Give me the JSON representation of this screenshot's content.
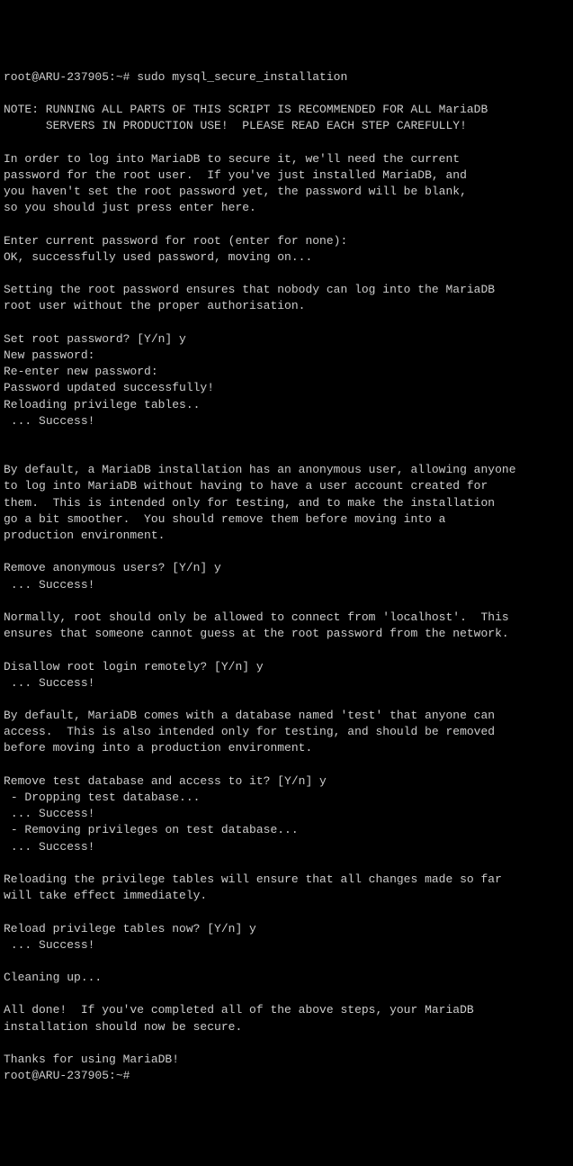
{
  "terminal": {
    "lines": [
      "root@ARU-237905:~# sudo mysql_secure_installation",
      "",
      "NOTE: RUNNING ALL PARTS OF THIS SCRIPT IS RECOMMENDED FOR ALL MariaDB",
      "      SERVERS IN PRODUCTION USE!  PLEASE READ EACH STEP CAREFULLY!",
      "",
      "In order to log into MariaDB to secure it, we'll need the current",
      "password for the root user.  If you've just installed MariaDB, and",
      "you haven't set the root password yet, the password will be blank,",
      "so you should just press enter here.",
      "",
      "Enter current password for root (enter for none):",
      "OK, successfully used password, moving on...",
      "",
      "Setting the root password ensures that nobody can log into the MariaDB",
      "root user without the proper authorisation.",
      "",
      "Set root password? [Y/n] y",
      "New password:",
      "Re-enter new password:",
      "Password updated successfully!",
      "Reloading privilege tables..",
      " ... Success!",
      "",
      "",
      "By default, a MariaDB installation has an anonymous user, allowing anyone",
      "to log into MariaDB without having to have a user account created for",
      "them.  This is intended only for testing, and to make the installation",
      "go a bit smoother.  You should remove them before moving into a",
      "production environment.",
      "",
      "Remove anonymous users? [Y/n] y",
      " ... Success!",
      "",
      "Normally, root should only be allowed to connect from 'localhost'.  This",
      "ensures that someone cannot guess at the root password from the network.",
      "",
      "Disallow root login remotely? [Y/n] y",
      " ... Success!",
      "",
      "By default, MariaDB comes with a database named 'test' that anyone can",
      "access.  This is also intended only for testing, and should be removed",
      "before moving into a production environment.",
      "",
      "Remove test database and access to it? [Y/n] y",
      " - Dropping test database...",
      " ... Success!",
      " - Removing privileges on test database...",
      " ... Success!",
      "",
      "Reloading the privilege tables will ensure that all changes made so far",
      "will take effect immediately.",
      "",
      "Reload privilege tables now? [Y/n] y",
      " ... Success!",
      "",
      "Cleaning up...",
      "",
      "All done!  If you've completed all of the above steps, your MariaDB",
      "installation should now be secure.",
      "",
      "Thanks for using MariaDB!",
      "root@ARU-237905:~#"
    ]
  }
}
